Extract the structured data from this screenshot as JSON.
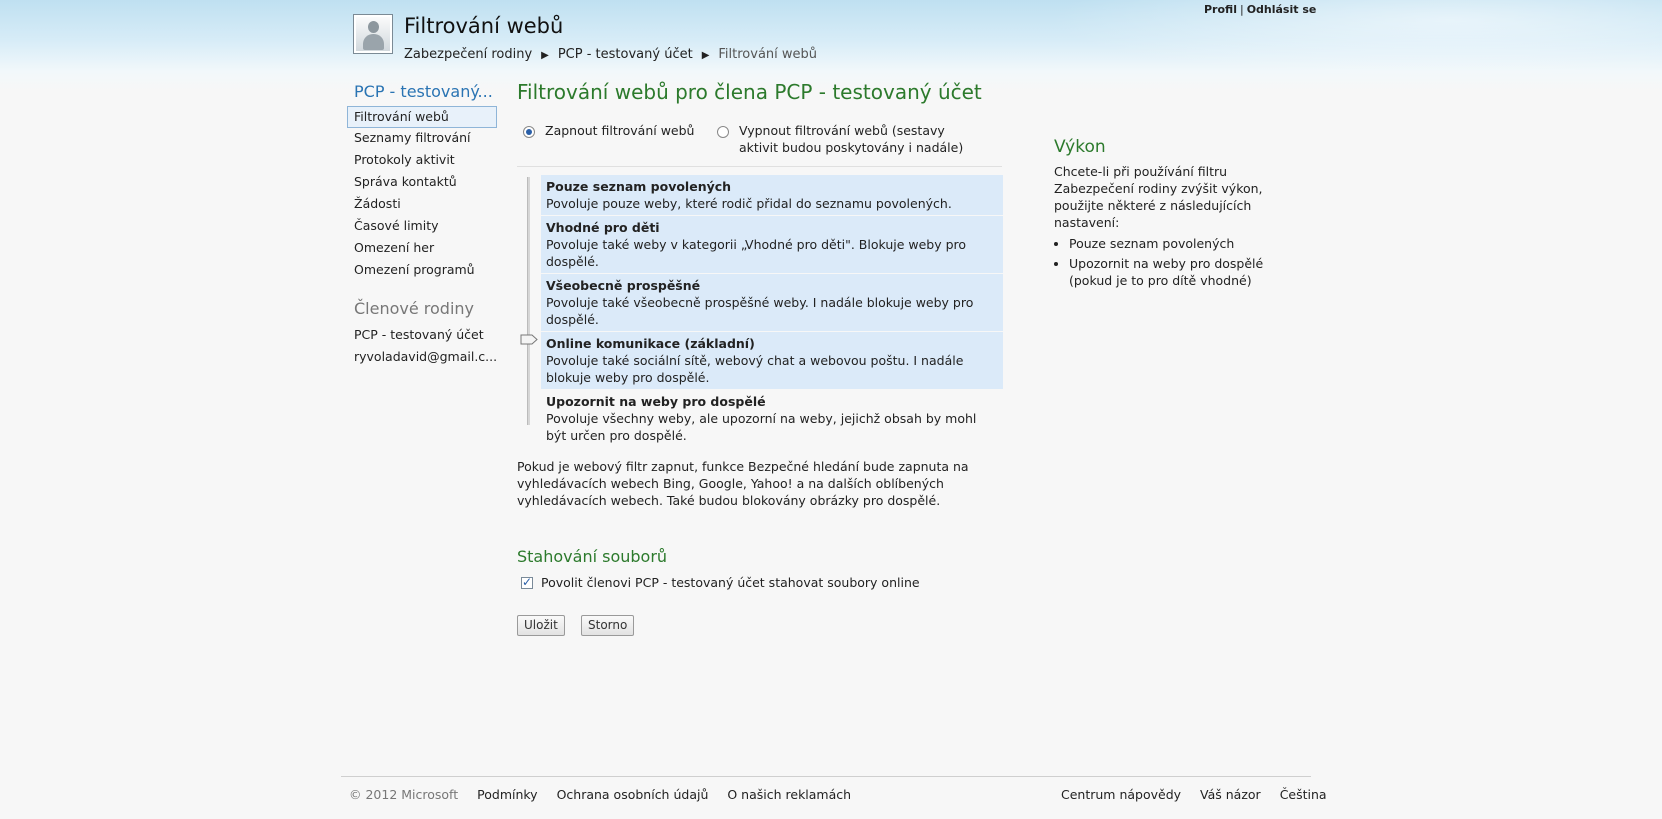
{
  "header": {
    "title": "Filtrování webů",
    "breadcrumb": [
      "Zabezpečení rodiny",
      "PCP - testovaný účet",
      "Filtrování webů"
    ],
    "top_links": {
      "profile": "Profil",
      "sign_out": "Odhlásit se"
    }
  },
  "sidebar": {
    "heading": "PCP - testovaný...",
    "items": [
      {
        "label": "Filtrování webů",
        "active": true
      },
      {
        "label": "Seznamy filtrování"
      },
      {
        "label": "Protokoly aktivit"
      },
      {
        "label": "Správa kontaktů"
      },
      {
        "label": "Žádosti"
      },
      {
        "label": "Časové limity"
      },
      {
        "label": "Omezení her"
      },
      {
        "label": "Omezení programů"
      }
    ],
    "members_heading": "Členové rodiny",
    "members": [
      "PCP - testovaný účet",
      "ryvoladavid@gmail.c..."
    ]
  },
  "main": {
    "title": "Filtrování webů pro člena PCP - testovaný účet",
    "radio_on": "Zapnout filtrování webů",
    "radio_off": "Vypnout filtrování webů (sestavy aktivit budou poskytovány i nadále)",
    "levels": [
      {
        "title": "Pouze seznam povolených",
        "desc": "Povoluje pouze weby, které rodič přidal do seznamu povolených.",
        "selected": true
      },
      {
        "title": "Vhodné pro děti",
        "desc": "Povoluje také weby v kategorii „Vhodné pro děti\". Blokuje weby pro dospělé.",
        "selected": true
      },
      {
        "title": "Všeobecně prospěšné",
        "desc": "Povoluje také všeobecně prospěšné weby. I nadále blokuje weby pro dospělé.",
        "selected": true
      },
      {
        "title": "Online komunikace (základní)",
        "desc": "Povoluje také sociální sítě, webový chat a webovou poštu. I nadále blokuje weby pro dospělé.",
        "selected": true
      },
      {
        "title": "Upozornit na weby pro dospělé",
        "desc": "Povoluje všechny weby, ale upozorní na weby, jejichž obsah by mohl být určen pro dospělé.",
        "selected": false
      }
    ],
    "safe_search_note": "Pokud je webový filtr zapnut, funkce Bezpečné hledání bude zapnuta na vyhledávacích webech Bing, Google, Yahoo! a na dalších oblíbených vyhledávacích webech. Také budou blokovány obrázky pro dospělé.",
    "downloads_heading": "Stahování souborů",
    "downloads_checkbox": "Povolit členovi PCP - testovaný účet stahovat soubory online",
    "save_label": "Uložit",
    "cancel_label": "Storno"
  },
  "performance": {
    "heading": "Výkon",
    "text": "Chcete-li při používání filtru Zabezpečení rodiny zvýšit výkon, použijte některé z následujících nastavení:",
    "bullets": [
      "Pouze seznam povolených",
      "Upozornit na weby pro dospělé (pokud je to pro dítě vhodné)"
    ]
  },
  "footer": {
    "copyright": "© 2012 Microsoft",
    "left_links": [
      "Podmínky",
      "Ochrana osobních údajů",
      "O našich reklamách"
    ],
    "right_links": [
      "Centrum nápovědy",
      "Váš názor",
      "Čeština"
    ]
  },
  "colors": {
    "heading_green": "#2c7a2c",
    "link_blue": "#2a74b3",
    "selected_bg": "#dbeaf9"
  }
}
